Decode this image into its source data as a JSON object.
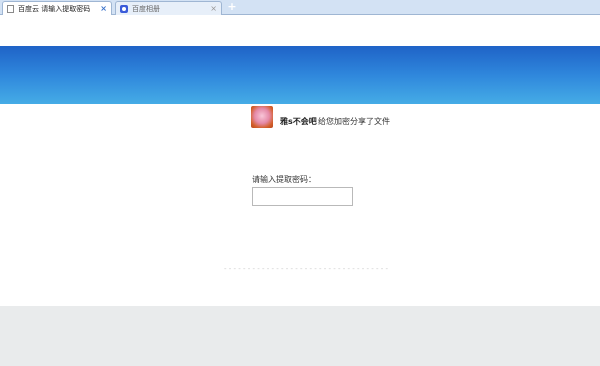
{
  "tabs": [
    {
      "label": "百度云 请输入提取密码",
      "icon": "page-icon",
      "active": true
    },
    {
      "label": "百度相册",
      "icon": "baidu-paw-icon",
      "active": false
    }
  ],
  "tab_close_glyph": "×",
  "new_tab_glyph": "+",
  "share": {
    "username": "雅s不会吧",
    "message": "给您加密分享了文件"
  },
  "password": {
    "label": "请输入提取密码：",
    "value": ""
  },
  "colors": {
    "banner_top": "#1f63c7",
    "banner_bottom": "#45ace6",
    "footer_bg": "#e9ebec"
  }
}
